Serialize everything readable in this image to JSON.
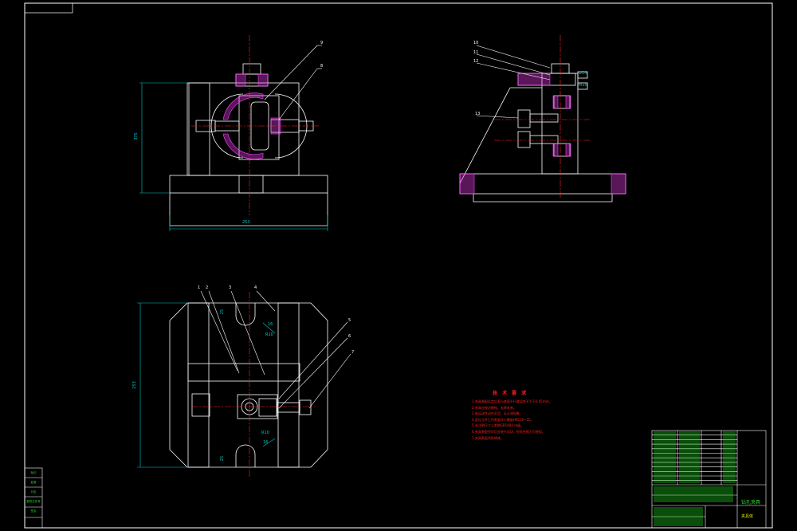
{
  "drawing": {
    "frame_colors": {
      "border": "#ffffff",
      "dimension": "#00c8c8",
      "centerline": "#ff2020",
      "part": "#ffffff",
      "hatch": "#ff40ff",
      "title_block": "#20e020"
    },
    "front_view": {
      "dim_height": "375",
      "dim_width": "253",
      "balloons": [
        "9",
        "8"
      ]
    },
    "side_view": {
      "balloons": [
        "10",
        "11",
        "12",
        "13"
      ],
      "labels": [
        "Φ14",
        "M30"
      ]
    },
    "top_view": {
      "dim_height": "253",
      "balloons": [
        "1",
        "2",
        "3",
        "4",
        "5",
        "6",
        "7"
      ],
      "radius_labels": [
        "R10",
        "R10"
      ],
      "small_dims": [
        "25",
        "25",
        "16",
        "16"
      ]
    },
    "tech_requirements": {
      "title": "技 术 要 求",
      "lines": [
        "1.夹具装配后定位面与底面平行度误差不大于0.05mm。",
        "2.夹具应锐边倒钝，去除毛刺。",
        "3.各运动件动作灵活，无卡滞现象。",
        "4.定位元件工作表面淬火硬度HRC50~55。",
        "5.未注明尺寸公差按GB1804-m级。",
        "6.夹具装配完毕后应进行试切，检验合格方可使用。",
        "7.夹具表面涂防锈漆。"
      ]
    },
    "title_block": {
      "part_name": "钻孔夹具",
      "sub_name": "夹具体",
      "rows": [
        "12",
        "11",
        "10",
        "9",
        "8",
        "7",
        "6",
        "5",
        "4",
        "3",
        "2",
        "1"
      ]
    },
    "revision_box": [
      "标记",
      "处数",
      "分区",
      "更改文件号",
      "签名"
    ]
  }
}
